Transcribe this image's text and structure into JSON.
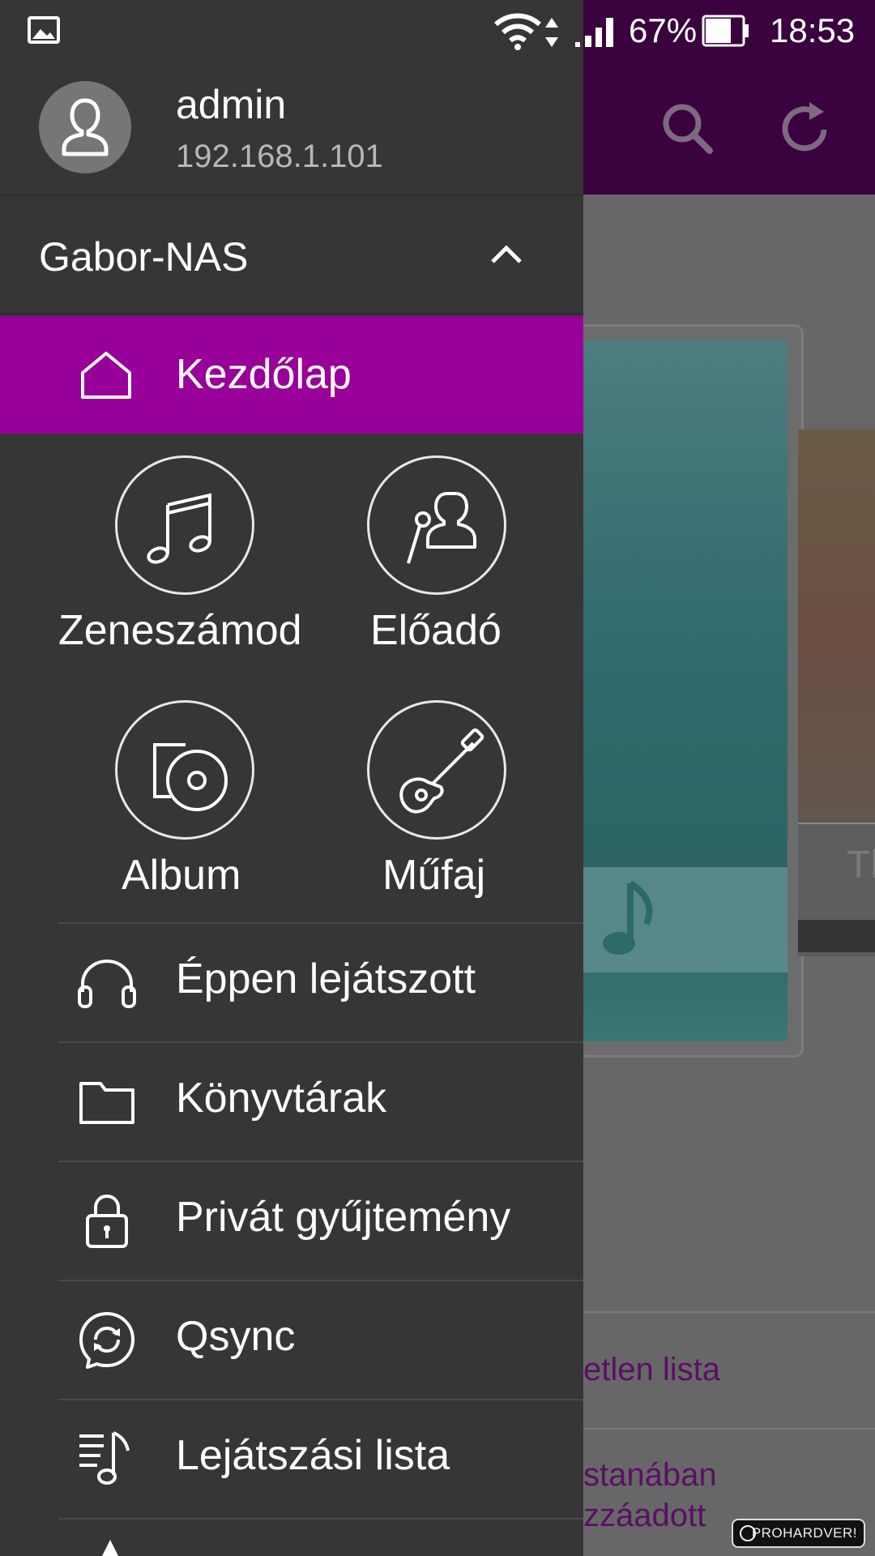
{
  "status_bar": {
    "battery_percent": "67%",
    "time": "18:53",
    "icons": [
      "image-notification-icon",
      "wifi-icon",
      "data-arrows-icon",
      "signal-icon",
      "battery-icon"
    ]
  },
  "background_app": {
    "toolbar_icons": [
      "search-icon",
      "refresh-icon"
    ],
    "card_text": "Tl",
    "row_texts": [
      "etlen lista",
      "stanában",
      "zzáadott"
    ],
    "watermark": "PROHARDVER!"
  },
  "drawer": {
    "user": {
      "name": "admin",
      "ip": "192.168.1.101"
    },
    "nas": {
      "name": "Gabor-NAS"
    },
    "home": {
      "label": "Kezdőlap",
      "icon": "home-icon"
    },
    "grid": [
      {
        "label": "Zeneszámod",
        "icon": "music-note-icon"
      },
      {
        "label": "Előadó",
        "icon": "artist-icon"
      },
      {
        "label": "Album",
        "icon": "album-icon"
      },
      {
        "label": "Műfaj",
        "icon": "guitar-icon"
      }
    ],
    "items": [
      {
        "label": "Éppen lejátszott",
        "icon": "headphones-icon"
      },
      {
        "label": "Könyvtárak",
        "icon": "folder-icon"
      },
      {
        "label": "Privát gyűjtemény",
        "icon": "lock-icon"
      },
      {
        "label": "Qsync",
        "icon": "sync-icon"
      },
      {
        "label": "Lejátszási lista",
        "icon": "playlist-icon"
      }
    ]
  },
  "colors": {
    "drawer_bg": "#363636",
    "accent": "#980099",
    "toolbar": "#3a023e",
    "scrim": "#676767"
  }
}
